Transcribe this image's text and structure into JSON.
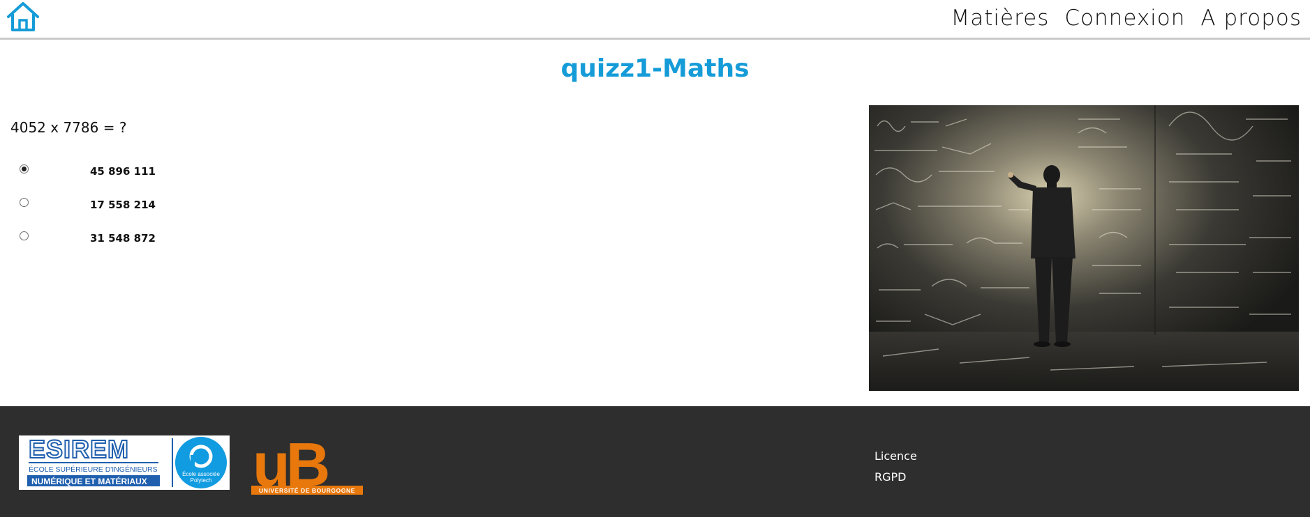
{
  "header": {
    "home_icon": "home-icon",
    "accent_color": "#159cd8",
    "nav": [
      {
        "label": "Matières"
      },
      {
        "label": "Connexion"
      },
      {
        "label": "A propos"
      }
    ]
  },
  "quiz": {
    "title": "quizz1-Maths",
    "question": "4052 x 7786 = ?",
    "answers": [
      {
        "label": "45 896 111",
        "selected": true
      },
      {
        "label": "17 558 214",
        "selected": false
      },
      {
        "label": "31 548 872",
        "selected": false
      }
    ],
    "illustration": "man-writing-math-formulas-on-chalkboard"
  },
  "footer": {
    "background": "#2e2e2e",
    "logos": {
      "esirem": {
        "name": "ESIREM",
        "line1": "ÉCOLE SUPÉRIEURE D'INGÉNIEURS",
        "line2": "NUMÉRIQUE ET MATÉRIAUX",
        "badge_line1": "École associée",
        "badge_line2": "Polytech"
      },
      "ub": {
        "mark": "uB",
        "caption": "UNIVERSITÉ DE BOURGOGNE",
        "color": "#e8780c"
      }
    },
    "links": [
      {
        "label": "Licence"
      },
      {
        "label": "RGPD"
      }
    ]
  }
}
